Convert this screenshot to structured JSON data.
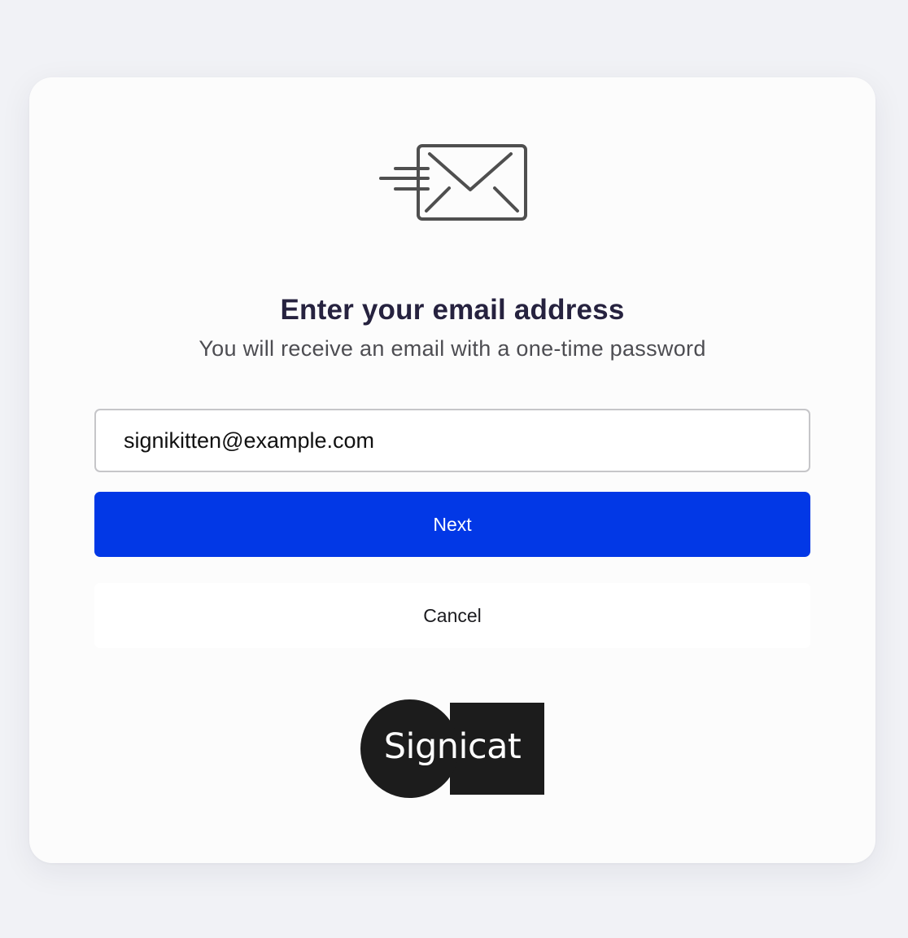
{
  "header": {
    "icon": "email-sending-icon",
    "title": "Enter your email address",
    "subtitle": "You will receive an email with a one-time password"
  },
  "form": {
    "email_value": "signikitten@example.com",
    "next_label": "Next",
    "cancel_label": "Cancel"
  },
  "footer": {
    "logo_text": "Signicat"
  },
  "colors": {
    "background": "#f1f2f6",
    "card": "#fcfcfc",
    "primary_button": "#0238e6",
    "title": "#26223f",
    "logo": "#1c1c1c"
  }
}
